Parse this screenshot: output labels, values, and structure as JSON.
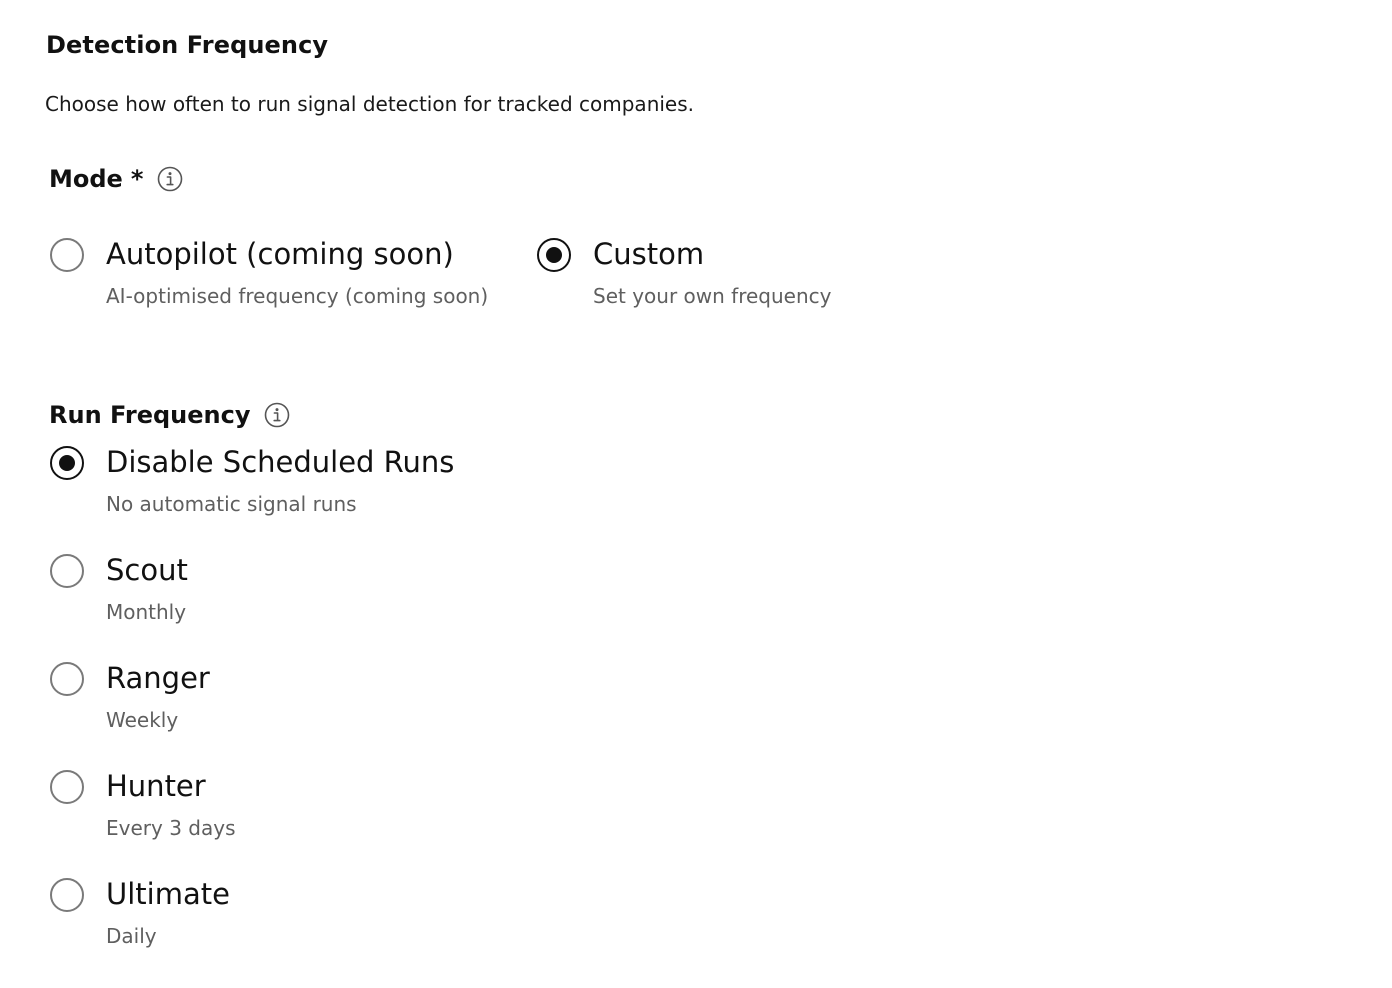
{
  "section": {
    "title": "Detection Frequency",
    "description": "Choose how often to run signal detection for tracked companies."
  },
  "mode": {
    "label": "Mode",
    "required_marker": "*",
    "options": [
      {
        "label": "Autopilot (coming soon)",
        "sublabel": "AI-optimised frequency (coming soon)",
        "selected": false
      },
      {
        "label": "Custom",
        "sublabel": "Set your own frequency",
        "selected": true
      }
    ]
  },
  "run_frequency": {
    "label": "Run Frequency",
    "options": [
      {
        "label": "Disable Scheduled Runs",
        "sublabel": "No automatic signal runs",
        "selected": true
      },
      {
        "label": "Scout",
        "sublabel": "Monthly",
        "selected": false
      },
      {
        "label": "Ranger",
        "sublabel": "Weekly",
        "selected": false
      },
      {
        "label": "Hunter",
        "sublabel": "Every 3 days",
        "selected": false
      },
      {
        "label": "Ultimate",
        "sublabel": "Daily",
        "selected": false
      }
    ]
  },
  "icons": {
    "info": "info-icon"
  }
}
